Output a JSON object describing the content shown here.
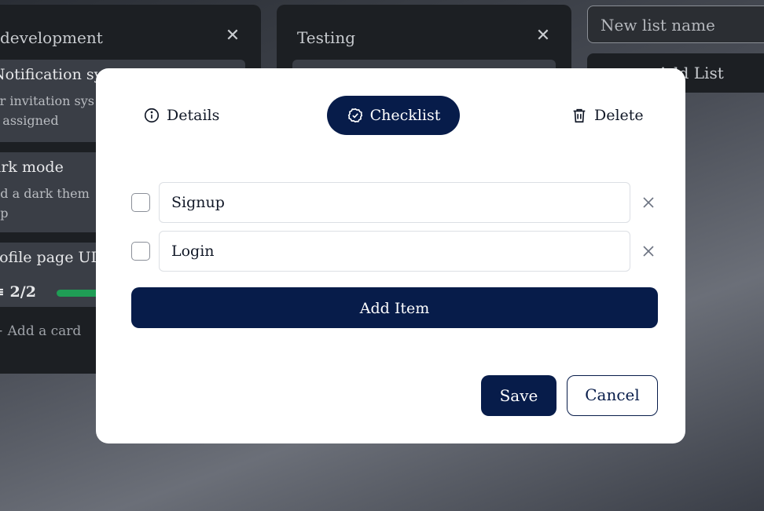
{
  "board": {
    "lists": [
      {
        "title": "development",
        "cards": [
          {
            "title": "Notification sy",
            "desc_line1": "or invitation sys",
            "desc_line2": "s assigned"
          },
          {
            "title": "ark mode",
            "desc_line1": "dd a dark them",
            "desc_line2": "pp"
          },
          {
            "title": "rofile page UI",
            "progress_text": "2/2",
            "progress": 1.0
          }
        ],
        "add_card_label": "Add a card"
      },
      {
        "title": "Testing"
      }
    ],
    "new_list_placeholder": "New list name",
    "add_list_label": "Add List"
  },
  "modal": {
    "tabs": {
      "details": "Details",
      "checklist": "Checklist",
      "delete": "Delete"
    },
    "checklist_items": [
      {
        "text": "Signup",
        "checked": false
      },
      {
        "text": "Login",
        "checked": false
      }
    ],
    "add_item_label": "Add Item",
    "save_label": "Save",
    "cancel_label": "Cancel"
  },
  "colors": {
    "primary": "#071c4a",
    "progress": "#1f9d55"
  }
}
